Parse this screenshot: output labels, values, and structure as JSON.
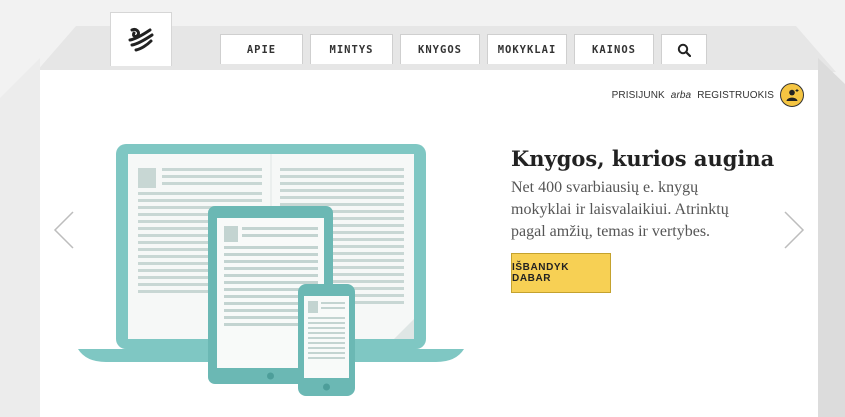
{
  "nav": {
    "items": [
      "APIE",
      "MINTYS",
      "KNYGOS",
      "MOKYKLAI",
      "KAINOS"
    ],
    "search_icon": "search-icon"
  },
  "auth": {
    "login": "PRISIJUNK",
    "or": "arba",
    "register": "REGISTRUOKIS"
  },
  "hero": {
    "title": "Knygos, kurios augina",
    "subtitle": "Net 400 svarbiausių e. knygų mokyklai ir laisvalaikiui. Atrinktų pagal amžių, temas ir vertybes.",
    "cta": "IŠBANDYK DABAR"
  },
  "colors": {
    "accent": "#f7d054",
    "device": "#7fc7c3",
    "device_dark": "#4d9e9a"
  },
  "icons": {
    "logo": "bird-logo-icon",
    "avatar": "user-icon",
    "prev": "chevron-left-icon",
    "next": "chevron-right-icon"
  }
}
